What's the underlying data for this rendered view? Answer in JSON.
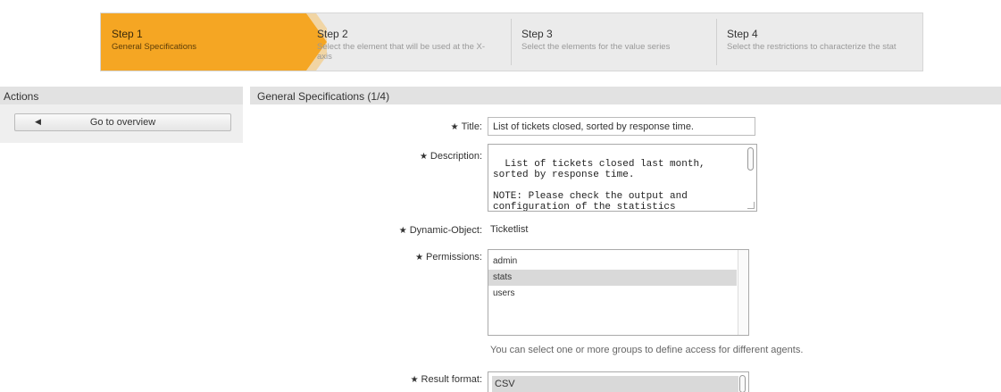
{
  "wizard": {
    "steps": [
      {
        "number": "Step 1",
        "desc": "General Specifications"
      },
      {
        "number": "Step 2",
        "desc": "Select the element that will be used at the X-axis"
      },
      {
        "number": "Step 3",
        "desc": "Select the elements for the value series"
      },
      {
        "number": "Step 4",
        "desc": "Select the restrictions to characterize the stat"
      }
    ]
  },
  "sidebar": {
    "title": "Actions",
    "overview_label": "Go to overview"
  },
  "main": {
    "title": "General Specifications (1/4)",
    "labels": {
      "title": "Title:",
      "description": "Description:",
      "dynamic_object": "Dynamic-Object:",
      "permissions": "Permissions:",
      "result_format": "Result format:"
    },
    "required_marker": "★",
    "title_value": "List of tickets closed, sorted by response time.",
    "description_value": "List of tickets closed last month,\nsorted by response time.\n\nNOTE: Please check the output and\nconfiguration of the statistics",
    "dynamic_object_value": "Ticketlist",
    "permissions": [
      {
        "label": "admin",
        "selected": false
      },
      {
        "label": "stats",
        "selected": true
      },
      {
        "label": "users",
        "selected": false
      }
    ],
    "permissions_hint": "You can select one or more groups to define access for different agents.",
    "result_format_selected": "CSV"
  },
  "colors": {
    "active_step": "#f5a623",
    "header_bg": "#e2e2e2"
  }
}
